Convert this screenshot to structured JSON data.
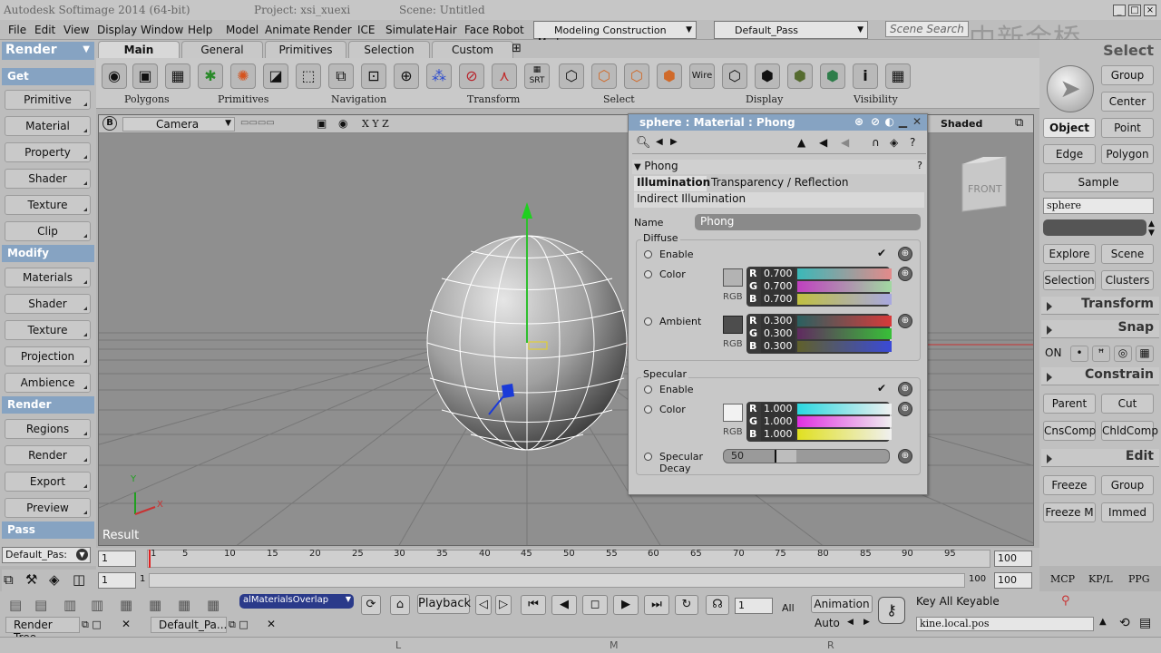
{
  "window": {
    "title": "Autodesk Softimage 2014 (64-bit)",
    "project": "Project: xsi_xuexi",
    "scene": "Scene: Untitled"
  },
  "menu": [
    "File",
    "Edit",
    "View",
    "Display",
    "Window",
    "Help",
    "Model",
    "Animate",
    "Render",
    "ICE",
    "Simulate",
    "Hair",
    "Face Robot"
  ],
  "mode_combo": "Modeling Construction Mode",
  "pass_combo": "Default_Pass",
  "scene_search": "Scene Search",
  "watermark": "中新金桥",
  "select_label": "Select",
  "left_panel": {
    "dropdown": "Render",
    "get_header": "Get",
    "get_items": [
      "Primitive",
      "Material",
      "Property",
      "Shader",
      "Texture",
      "Clip"
    ],
    "modify_header": "Modify",
    "modify_items": [
      "Materials",
      "Shader",
      "Texture",
      "Projection",
      "Ambience"
    ],
    "render_header": "Render",
    "render_items": [
      "Regions",
      "Render",
      "Export",
      "Preview"
    ],
    "pass_header": "Pass",
    "pass_value": "Default_Pas:"
  },
  "tabs": [
    "Main",
    "General",
    "Primitives",
    "Selection",
    "Custom"
  ],
  "toolbar_groups": [
    "Polygons",
    "Primitives",
    "Navigation",
    "Transform",
    "Select",
    "Display",
    "Visibility"
  ],
  "toolbar_srt": "SRT",
  "toolbar_wire": "Wire",
  "toolbar_info": "i",
  "viewport": {
    "badge": "B",
    "camera": "Camera",
    "axes": "X Y Z",
    "shaded": "Shaded",
    "cube_label": "FRONT",
    "result": "Result",
    "axis_x": "X",
    "axis_y": "Y"
  },
  "material_panel": {
    "title": "sphere : Material : Phong",
    "section": "Phong",
    "tabs": [
      "Illumination",
      "Transparency / Reflection"
    ],
    "subtab": "Indirect Illumination",
    "name_label": "Name",
    "name_value": "Phong",
    "diffuse": {
      "header": "Diffuse",
      "enable": "Enable",
      "color_label": "Color",
      "color_r": "0.700",
      "color_g": "0.700",
      "color_b": "0.700",
      "ambient_label": "Ambient",
      "ambient_r": "0.300",
      "ambient_g": "0.300",
      "ambient_b": "0.300",
      "rgb": "RGB"
    },
    "specular": {
      "header": "Specular",
      "enable": "Enable",
      "color_label": "Color",
      "color_r": "1.000",
      "color_g": "1.000",
      "color_b": "1.000",
      "decay_label_1": "Specular",
      "decay_label_2": "Decay",
      "decay_value": "50",
      "rgb": "RGB"
    },
    "channel_r": "R",
    "channel_g": "G",
    "channel_b": "B"
  },
  "right_panel": {
    "row1": [
      "Group",
      "Center"
    ],
    "row2": [
      "Object",
      "Point"
    ],
    "row3": [
      "Edge",
      "Polygon"
    ],
    "sample": "Sample",
    "object_name": "sphere",
    "explore": [
      "Explore",
      "Scene"
    ],
    "selection": [
      "Selection",
      "Clusters"
    ],
    "transform": "Transform",
    "snap": "Snap",
    "snap_on": "ON",
    "constrain": "Constrain",
    "constrain_row1": [
      "Parent",
      "Cut"
    ],
    "constrain_row2": [
      "CnsComp",
      "ChldComp"
    ],
    "edit": "Edit",
    "edit_row1": [
      "Freeze",
      "Group"
    ],
    "edit_row2": [
      "Freeze M",
      "Immed"
    ],
    "bottom_tabs": [
      "MCP",
      "KP/L",
      "PPG"
    ]
  },
  "timeline": {
    "start": "1",
    "ticks": [
      "1",
      "5",
      "10",
      "15",
      "20",
      "25",
      "30",
      "35",
      "40",
      "45",
      "50",
      "55",
      "60",
      "65",
      "70",
      "75",
      "80",
      "85",
      "90",
      "95"
    ],
    "end": "100",
    "range_start": "1",
    "range_start2": "1",
    "range_end": "100",
    "range_end2": "100"
  },
  "bottom": {
    "render_tree": "Render Tree",
    "default_pass": "Default_Pa...",
    "overlap_combo": "alMaterialsOverlap",
    "playback": "Playback",
    "frame": "1",
    "all": "All",
    "animation": "Animation",
    "auto": "Auto",
    "key_all": "Key All Keyable",
    "kine": "kine.local.pos",
    "status_l": "L",
    "status_m": "M",
    "status_r": "R"
  }
}
